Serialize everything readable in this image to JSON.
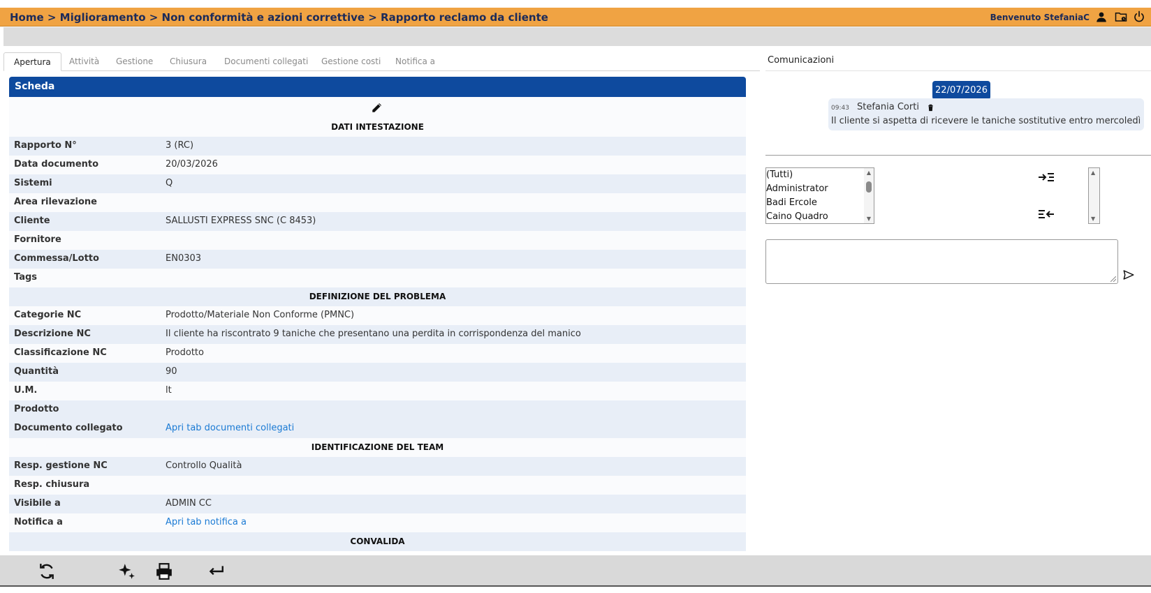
{
  "header": {
    "breadcrumb": "Home > Miglioramento > Non conformità e azioni correttive > Rapporto reclamo da cliente",
    "welcome": "Benvenuto StefaniaC",
    "icons": [
      "user-icon",
      "folder-clock-icon",
      "power-icon"
    ],
    "accent_color": "#f0a343"
  },
  "tabs": [
    {
      "label": "Apertura",
      "active": true
    },
    {
      "label": "Attività"
    },
    {
      "label": "Gestione"
    },
    {
      "label": "Chiusura"
    },
    {
      "label": "Documenti collegati"
    },
    {
      "label": "Gestione costi"
    },
    {
      "label": "Notifica a"
    }
  ],
  "scheda": {
    "title": "Scheda",
    "header_color": "#0e4a9e",
    "sections": {
      "dati": "DATI INTESTAZIONE",
      "problema": "DEFINIZIONE DEL PROBLEMA",
      "team": "IDENTIFICAZIONE DEL TEAM",
      "convalida": "CONVALIDA"
    },
    "fields": [
      {
        "label": "Rapporto N°",
        "value": "3 (RC)"
      },
      {
        "label": "Data documento",
        "value": "20/03/2026"
      },
      {
        "label": "Sistemi",
        "value": "Q"
      },
      {
        "label": "Area rilevazione",
        "value": ""
      },
      {
        "label": "Cliente",
        "value": "SALLUSTI EXPRESS SNC (C 8453)"
      },
      {
        "label": "Fornitore",
        "value": ""
      },
      {
        "label": "Commessa/Lotto",
        "value": "EN0303"
      },
      {
        "label": "Tags",
        "value": ""
      },
      {
        "label": "Categorie NC",
        "value": "Prodotto/Materiale Non Conforme (PMNC)"
      },
      {
        "label": "Descrizione NC",
        "value": "Il cliente ha riscontrato 9 taniche che presentano una perdita in corrispondenza del manico"
      },
      {
        "label": "Classificazione NC",
        "value": "Prodotto"
      },
      {
        "label": "Quantità",
        "value": "90"
      },
      {
        "label": "U.M.",
        "value": "lt"
      },
      {
        "label": "Prodotto",
        "value": ""
      },
      {
        "label": "Documento collegato",
        "value": "Apri tab documenti collegati"
      },
      {
        "label": "Resp. gestione NC",
        "value": "Controllo Qualità"
      },
      {
        "label": "Resp. chiusura",
        "value": ""
      },
      {
        "label": "Visibile a",
        "value": "ADMIN CC"
      },
      {
        "label": "Notifica a",
        "value": "Apri tab notifica a"
      }
    ]
  },
  "comunicazioni": {
    "title": "Comunicazioni",
    "date": "22/07/2026",
    "message": {
      "time": "09:43",
      "author": "Stefania Corti",
      "text": "Il cliente si aspetta di ricevere le taniche sostitutive entro mercoledì"
    },
    "recipients": [
      "(Tutti)",
      "Administrator",
      "Badi Ercole",
      "Caino Quadro"
    ],
    "message_placeholder": ""
  },
  "footer": {
    "icons": [
      "refresh-icon",
      "magic-sparkle-icon",
      "print-icon",
      "back-icon"
    ]
  }
}
